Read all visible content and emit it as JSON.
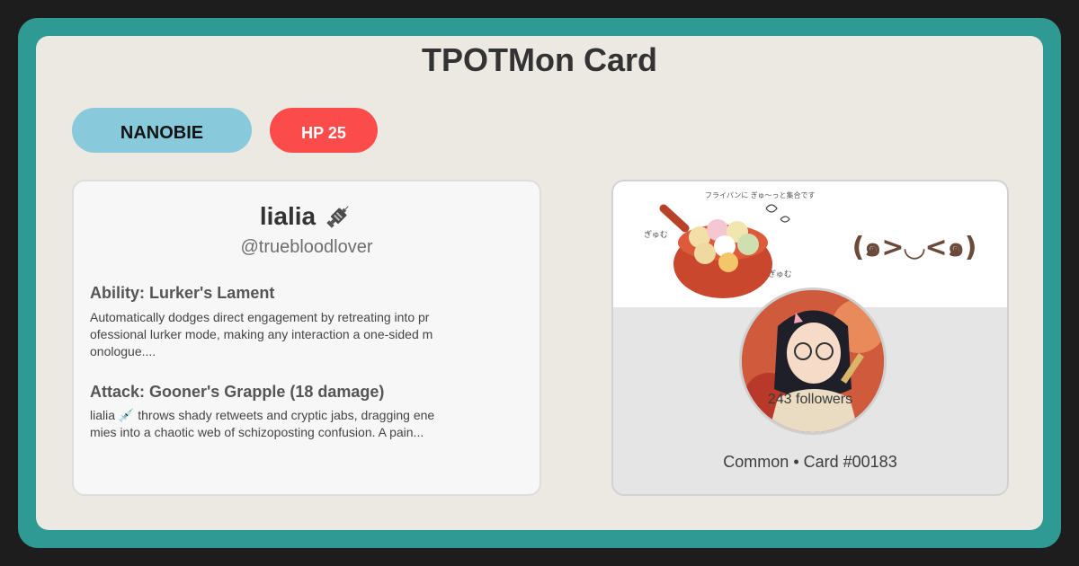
{
  "card": {
    "title": "TPOTMon Card",
    "type_label": "NANOBIE",
    "hp_label": "HP 25"
  },
  "profile": {
    "name": "lialia",
    "name_icon": "syringe-icon",
    "handle": "@truebloodlover"
  },
  "ability": {
    "title": "Ability: Lurker's Lament",
    "text": "Automatically dodges direct engagement by retreating into professional lurker mode, making any interaction a one-sided monologue...."
  },
  "attack": {
    "title": "Attack: Gooner's Grapple (18 damage)",
    "text": "lialia 💉 throws shady retweets and cryptic jabs, dragging enemies into a chaotic web of schizoposting confusion. A pain..."
  },
  "image_panel": {
    "banner_kaomoji": "(๑>◡<๑)",
    "banner_caption_top": "フライパンに ぎゅ〜っと集合です",
    "banner_caption_left": "ぎゅむ",
    "banner_caption_right": "ぎゅむ",
    "followers": "243 followers",
    "footer": "Common • Card #00183"
  },
  "colors": {
    "frame": "#2f9a94",
    "card_bg": "#ece9e2",
    "type_pill": "#89c9dc",
    "hp_pill": "#fb4c4b"
  }
}
